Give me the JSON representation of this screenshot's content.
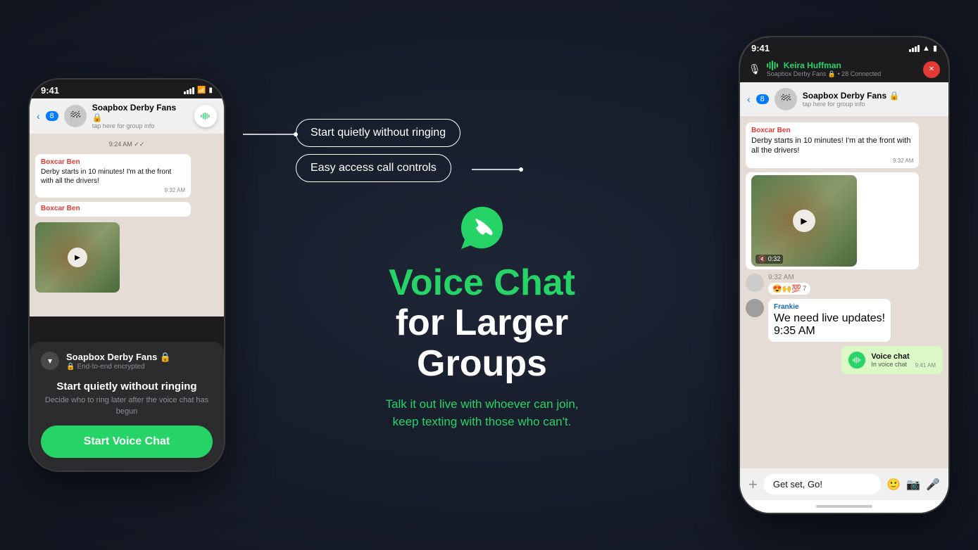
{
  "leftPhone": {
    "statusBar": {
      "time": "9:41"
    },
    "chatHeader": {
      "backLabel": "8",
      "groupName": "Soapbox Derby Fans 🔒",
      "subText": "tap here for group info"
    },
    "messages": {
      "timestamp": "9:24 AM ✓✓",
      "senderName": "Boxcar Ben",
      "msgText": "Derby starts in 10 minutes! I'm at the front with all the drivers!",
      "msgTime": "9:32 AM",
      "videoThumb": "video"
    },
    "bottomSheet": {
      "groupName": "Soapbox Derby Fans 🔒",
      "encrypted": "End-to-end encrypted",
      "title": "Start quietly without ringing",
      "desc": "Decide who to ring later after the voice chat has begun",
      "btnLabel": "Start Voice Chat"
    }
  },
  "center": {
    "callout1": "Start quietly without ringing",
    "callout2": "Easy access call controls",
    "title": {
      "line1": "Voice Chat",
      "line2": "for Larger",
      "line3": "Groups"
    },
    "subtitle": "Talk it out live with whoever can join,\nkeep texting with those who can't."
  },
  "rightPhone": {
    "statusBar": {
      "time": "9:41"
    },
    "callBar": {
      "callerName": "Keira Huffman",
      "groupSub": "Soapbox Derby Fans 🔒 • 28 Connected"
    },
    "chatHeader": {
      "backLabel": "8",
      "groupName": "Soapbox Derby Fans 🔒",
      "subText": "tap here for group info"
    },
    "messages": {
      "senderName": "Boxcar Ben",
      "msgText": "Derby starts in 10 minutes! I'm at the front with all the drivers!",
      "msgTime": "9:32 AM",
      "videoDuration": "🔇 0:32",
      "reactions": "😍🙌💯",
      "reactCount": "7",
      "frankieName": "Frankie",
      "frankieMsg": "We need live updates!",
      "frankieTime": "9:35 AM",
      "voiceChatTitle": "Voice chat",
      "voiceChatSub": "In voice chat",
      "voiceChatTime": "9:41 AM"
    },
    "inputBar": {
      "placeholder": "Get set, Go!",
      "value": "Get set, Go!"
    }
  }
}
